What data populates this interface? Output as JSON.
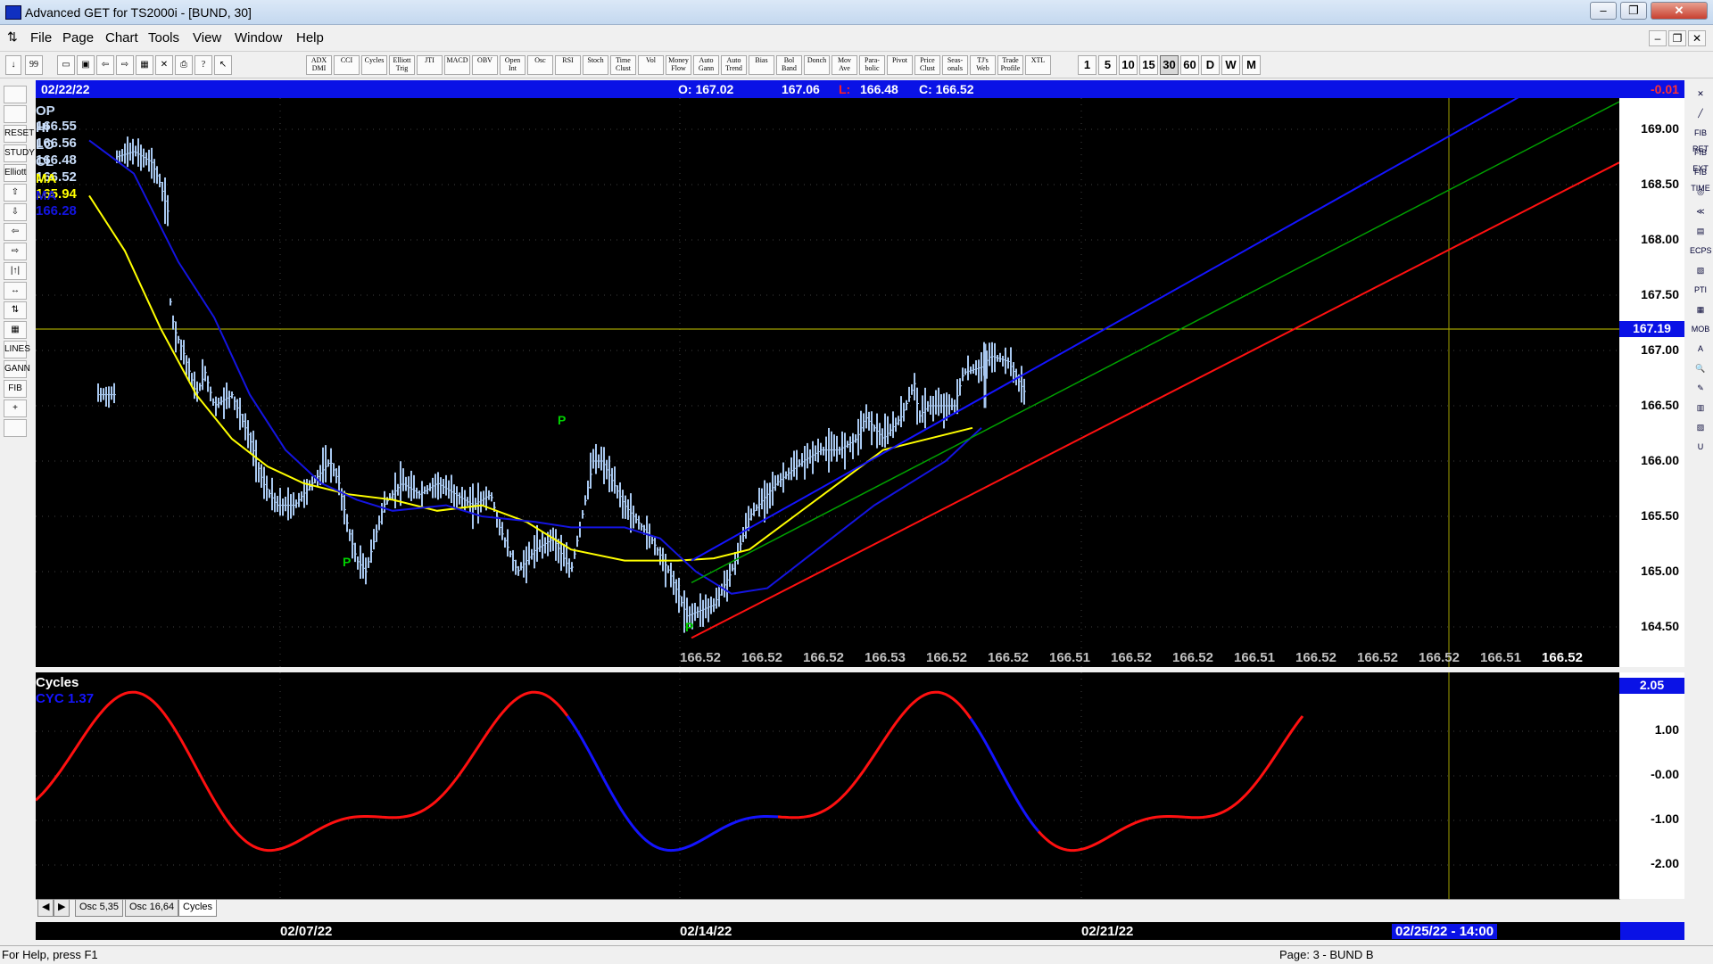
{
  "window": {
    "title": "Advanced GET for TS2000i - [BUND, 30]",
    "minimize": "–",
    "restore": "❐",
    "close": "✕"
  },
  "menu": [
    "File",
    "Page",
    "Chart",
    "Tools",
    "View",
    "Window",
    "Help"
  ],
  "mdi": {
    "minimize": "–",
    "restore": "❐",
    "close": "✕"
  },
  "toolbar": {
    "icons": [
      "↓",
      "99"
    ],
    "file_icons": [
      "new-doc-icon",
      "save-icon",
      "back-icon",
      "forward-icon",
      "grid-icon",
      "cross-icon",
      "print-icon",
      "help-icon",
      "pointer-help-icon"
    ],
    "studies": [
      "ADX DMI",
      "CCI",
      "Cycles",
      "Elliott Trig",
      "JTI",
      "MACD",
      "OBV",
      "Open Int",
      "Osc",
      "RSI",
      "Stoch",
      "Time Clust",
      "Vol",
      "Money Flow",
      "Auto Gann",
      "Auto Trend",
      "Bias",
      "Bol Band",
      "Donch",
      "Mov Ave",
      "Para-bolic",
      "Pivot",
      "Price Clust",
      "Seas-onals",
      "TJ's Web",
      "Trade Profile",
      "XTL"
    ],
    "timeframes": [
      "1",
      "5",
      "10",
      "15",
      "30",
      "60",
      "D",
      "W",
      "M"
    ],
    "active_timeframe": "30"
  },
  "left_tools": [
    "open-icon",
    "zoom-icon",
    "reset-icon",
    "study-icon",
    "elliott-icon",
    "arrow-up-icon",
    "arrow-down-icon",
    "arrow-left-icon",
    "arrow-right-icon",
    "bars-icon",
    "expand-icon",
    "scale-icon",
    "grid-icon",
    "lines-icon",
    "gann-icon",
    "fib-icon",
    "cross-icon",
    "print-icon"
  ],
  "left_tool_labels": [
    "",
    "",
    "RESET",
    "STUDY",
    "Elliott",
    "⇧",
    "⇩",
    "⇦",
    "⇨",
    "|↑|",
    "↔",
    "⇅",
    "▦",
    "LINES",
    "GANN",
    "FIB",
    "+",
    ""
  ],
  "right_tools": [
    "✕",
    "╱",
    "FIB RET",
    "FIB EXT",
    "FIB TIME",
    "◎",
    "≪",
    "▤",
    "ECPS",
    "▧",
    "PTI",
    "▦",
    "MOB",
    "A",
    "🔍",
    "✎",
    "▥",
    "▨",
    "U"
  ],
  "info": {
    "date": "02/22/22",
    "open": "O: 167.02",
    "high": "167.06",
    "low_label": "L:",
    "low": "166.48",
    "close": "C: 166.52",
    "change": "-0.01"
  },
  "ohlc": {
    "op": "OP  166.55",
    "hi": "HI   166.56",
    "lo": "LO  166.48",
    "cl": "CL  166.52",
    "ma1": "MA  165.94",
    "ma2": "MA  166.28"
  },
  "price_axis": {
    "labels": [
      "169.00",
      "168.50",
      "168.00",
      "167.50",
      "167.00",
      "166.50",
      "166.00",
      "165.50",
      "165.00",
      "164.50"
    ],
    "current": "167.19"
  },
  "cycle_axis": {
    "labels": [
      "1.00",
      "-0.00",
      "-1.00",
      "-2.00"
    ],
    "current": "2.05"
  },
  "cycles": {
    "title": "Cycles",
    "value": "CYC 1.37"
  },
  "projection": [
    "166.52",
    "166.52",
    "166.52",
    "166.53",
    "166.52",
    "166.52",
    "166.51",
    "166.52",
    "166.52",
    "166.51",
    "166.52",
    "166.52",
    "166.52",
    "166.51",
    "166.52"
  ],
  "pivots": [
    "P",
    "P",
    "P"
  ],
  "dates": [
    "02/07/22",
    "02/14/22",
    "02/21/22"
  ],
  "future_date": "02/25/22 - 14:00",
  "tabs": [
    "Osc 5,35",
    "Osc 16,64",
    "Cycles"
  ],
  "tab_nav": [
    "◀",
    "▶"
  ],
  "status": {
    "help": "For Help, press F1",
    "page": "Page: 3 - BUND B"
  },
  "colors": {
    "infobar": "#0a12e6",
    "ma_yellow": "#ffff00",
    "ma_blue": "#1414e0",
    "bars": "#a8c8f0",
    "pivot": "#00d000",
    "cycle_red": "#ff1010",
    "cycle_blue": "#1414ff"
  }
}
